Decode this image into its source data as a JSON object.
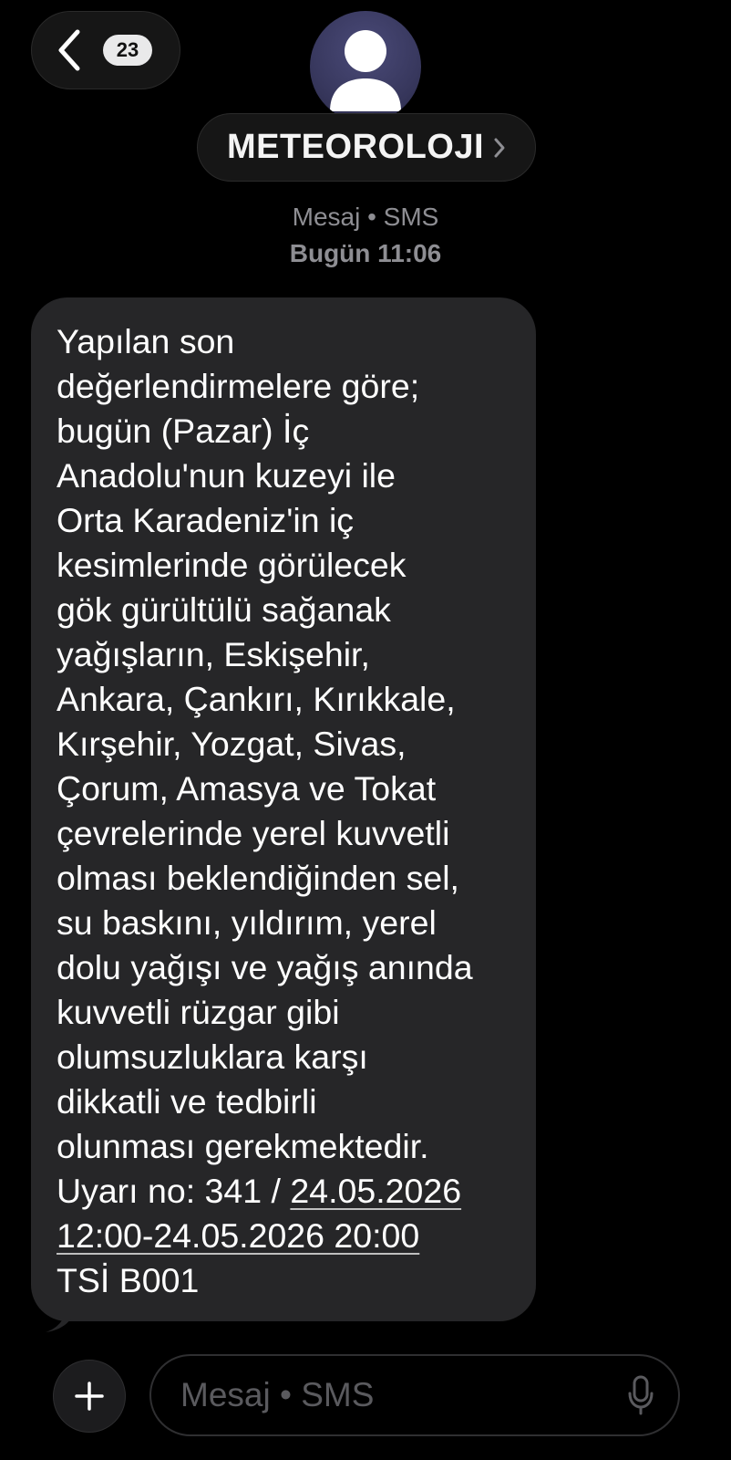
{
  "nav": {
    "unread_count": "23"
  },
  "conversation": {
    "sender": "METEOROLOJI",
    "message_type": "Mesaj • SMS",
    "timestamp": "Bugün 11:06"
  },
  "message": {
    "body": "Yapılan son\ndeğerlendirmelere göre;\nbugün (Pazar) İç\nAnadolu'nun kuzeyi ile\nOrta Karadeniz'in iç\nkesimlerinde görülecek\ngök gürültülü sağanak\nyağışların, Eskişehir,\nAnkara, Çankırı, Kırıkkale,\nKırşehir, Yozgat, Sivas,\nÇorum, Amasya ve Tokat\nçevrelerinde yerel kuvvetli\nolması beklendiğinden sel,\nsu baskını, yıldırım, yerel\ndolu yağışı ve yağış anında\nkuvvetli rüzgar gibi\nolumsuzluklara karşı\ndikkatli ve tedbirli\nolunması gerekmektedir.",
    "warning_prefix": "Uyarı no: 341 / ",
    "date_start": "24.05.2026",
    "date_range_rest": "12:00-24.05.2026 20:00",
    "footer": "TSİ B001"
  },
  "composer": {
    "placeholder": "Mesaj • SMS"
  },
  "icons": {
    "back": "chevron-left-icon",
    "avatar": "person-icon",
    "sender_arrow": "chevron-right-icon",
    "plus": "plus-icon",
    "mic": "microphone-icon"
  },
  "colors": {
    "background": "#000000",
    "bubble": "#262628",
    "meta_text": "#8e8e93",
    "badge": "#e9e9ea",
    "placeholder": "#5a5a5e"
  }
}
